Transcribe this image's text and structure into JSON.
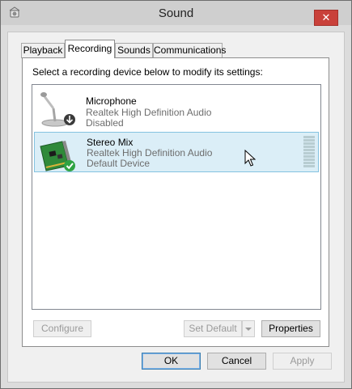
{
  "window": {
    "title": "Sound",
    "close_label": "✕"
  },
  "tabs": [
    {
      "label": "Playback",
      "active": false
    },
    {
      "label": "Recording",
      "active": true
    },
    {
      "label": "Sounds",
      "active": false
    },
    {
      "label": "Communications",
      "active": false
    }
  ],
  "recording": {
    "instructions": "Select a recording device below to modify its settings:",
    "devices": [
      {
        "name": "Microphone",
        "driver": "Realtek High Definition Audio",
        "status": "Disabled",
        "icon": "microphone-icon",
        "selected": false
      },
      {
        "name": "Stereo Mix",
        "driver": "Realtek High Definition Audio",
        "status": "Default Device",
        "icon": "sound-card-icon",
        "selected": true
      }
    ],
    "buttons": {
      "configure": "Configure",
      "set_default": "Set Default",
      "properties": "Properties"
    }
  },
  "footer": {
    "ok": "OK",
    "cancel": "Cancel",
    "apply": "Apply"
  },
  "colors": {
    "selection_bg": "#dbeef7",
    "selection_border": "#84c2e0",
    "close_button": "#c9413a",
    "default_check": "#2ea343"
  }
}
